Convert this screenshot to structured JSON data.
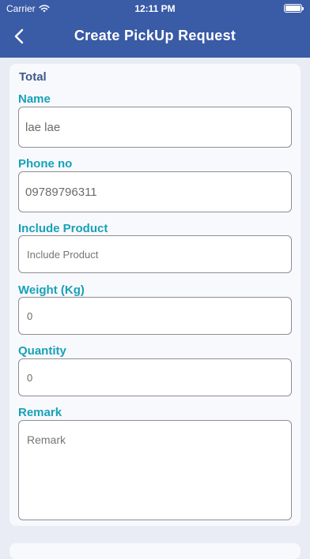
{
  "status_bar": {
    "carrier": "Carrier",
    "time": "12:11 PM"
  },
  "nav": {
    "title": "Create PickUp Request"
  },
  "form": {
    "total_label": "Total",
    "name": {
      "label": "Name",
      "value": "lae lae"
    },
    "phone": {
      "label": "Phone no",
      "value": "09789796311"
    },
    "include_product": {
      "label": "Include Product",
      "placeholder": "Include Product"
    },
    "weight": {
      "label": "Weight (Kg)",
      "value": "0"
    },
    "quantity": {
      "label": "Quantity",
      "value": "0"
    },
    "remark": {
      "label": "Remark",
      "placeholder": "Remark"
    }
  },
  "colors": {
    "header": "#3a5ba6",
    "label": "#17a1b8",
    "total": "#3c5a8c",
    "background": "#e9ecf4"
  },
  "icons": [
    "wifi-icon",
    "battery-icon",
    "back-chevron-icon"
  ]
}
